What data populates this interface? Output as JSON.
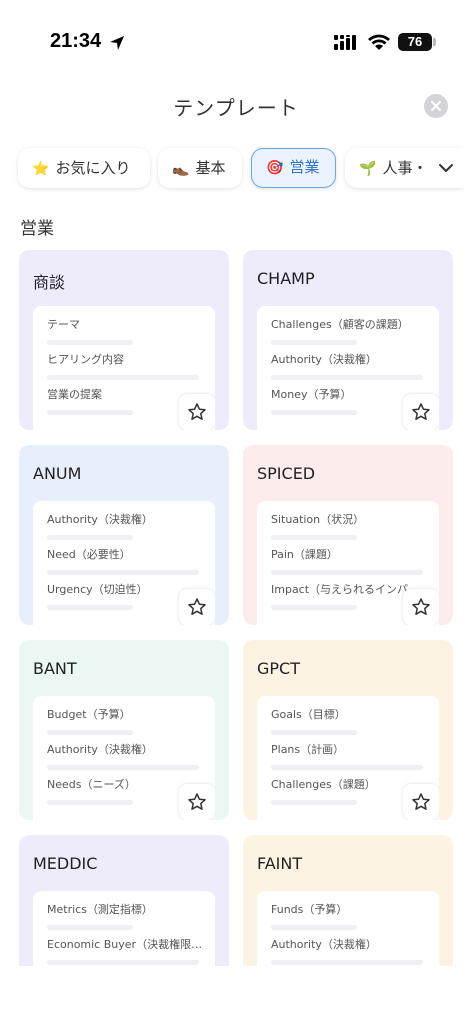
{
  "status": {
    "time": "21:34",
    "battery": "76"
  },
  "header": {
    "title": "テンプレート"
  },
  "tabs": [
    {
      "icon": "⭐",
      "label": "お気に入り"
    },
    {
      "icon": "👞",
      "label": "基本"
    },
    {
      "icon": "🎯",
      "label": "営業"
    },
    {
      "icon": "🌱",
      "label": "人事・"
    }
  ],
  "section": {
    "title": "営業"
  },
  "colors": {
    "active_tab_border": "#6aa6ec",
    "active_tab_text": "#2f74c8"
  },
  "cards": [
    {
      "title": "商談",
      "bg": "#eeebfb",
      "items": [
        "テーマ",
        "ヒアリング内容",
        "営業の提案"
      ]
    },
    {
      "title": "CHAMP",
      "bg": "#eeebfb",
      "items": [
        "Challenges（顧客の課題）",
        "Authority（決裁権）",
        "Money（予算）"
      ]
    },
    {
      "title": "ANUM",
      "bg": "#e6effb",
      "items": [
        "Authority（決裁権）",
        "Need（必要性）",
        "Urgency（切迫性）"
      ]
    },
    {
      "title": "SPICED",
      "bg": "#fcecec",
      "items": [
        "Situation（状況）",
        "Pain（課題）",
        "Impact（与えられるインパクト）"
      ]
    },
    {
      "title": "BANT",
      "bg": "#eaf7f3",
      "items": [
        "Budget（予算）",
        "Authority（決裁権）",
        "Needs（ニーズ）"
      ]
    },
    {
      "title": "GPCT",
      "bg": "#fdf3e3",
      "items": [
        "Goals（目標）",
        "Plans（計画）",
        "Challenges（課題）"
      ]
    },
    {
      "title": "MEDDIC",
      "bg": "#eeebfb",
      "items": [
        "Metrics（測定指標）",
        "Economic Buyer（決裁権限…",
        ""
      ]
    },
    {
      "title": "FAINT",
      "bg": "#fdf3e3",
      "items": [
        "Funds（予算）",
        "Authority（決裁権）",
        ""
      ]
    }
  ]
}
